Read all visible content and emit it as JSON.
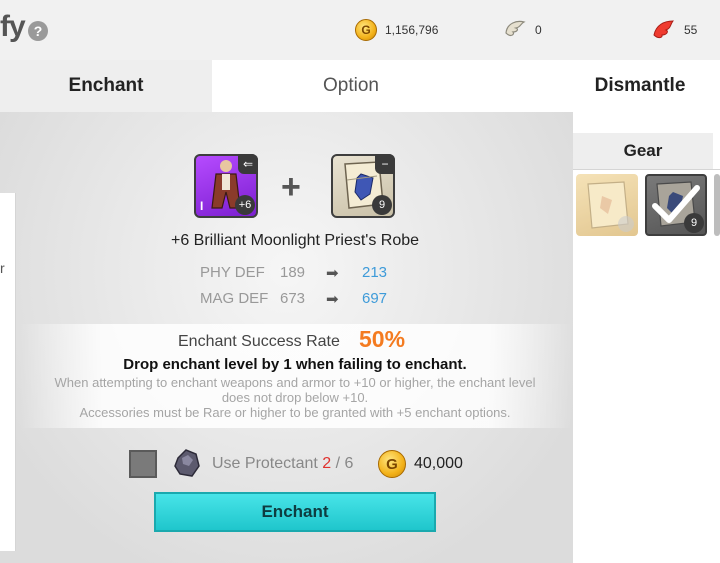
{
  "header": {
    "title": "fy",
    "help_icon": "question-icon",
    "gold": {
      "icon": "gold-coin-icon",
      "value": "1,156,796",
      "letter": "G"
    },
    "wings": {
      "icon": "wing-icon",
      "value": "0"
    },
    "feathers": {
      "icon": "red-feather-icon",
      "value": "55"
    }
  },
  "tabs": [
    {
      "label": "Enchant",
      "active": true
    },
    {
      "label": "Option",
      "active": false
    },
    {
      "label": "Dismantle",
      "active": false
    }
  ],
  "enchant": {
    "target_item": {
      "icon": "robe-icon",
      "level_badge": "+6",
      "grade": "I"
    },
    "material_item": {
      "icon": "enchant-scroll-icon",
      "count": "9"
    },
    "plus_symbol": "+",
    "item_name": "+6 Brilliant Moonlight Priest's Robe",
    "stats": [
      {
        "label": "PHY DEF",
        "from": "189",
        "to": "213"
      },
      {
        "label": "MAG DEF",
        "from": "673",
        "to": "697"
      }
    ],
    "success_rate_label": "Enchant Success Rate",
    "success_rate_value": "50%",
    "failure_text": "Drop enchant level by 1 when failing to enchant.",
    "notes": [
      "When attempting to enchant weapons and armor to +10 or higher, the enchant level",
      "does not drop below +10.",
      "Accessories must be Rare or higher to be granted with +5 enchant options."
    ],
    "protectant": {
      "label": "Use Protectant",
      "owned": "2",
      "separator": "/",
      "required": "6",
      "checked": false
    },
    "cost": {
      "value": "40,000",
      "letter": "G"
    },
    "button_label": "Enchant"
  },
  "gear_panel": {
    "tab_label": "Gear",
    "slots": [
      {
        "icon": "faded-scroll-icon"
      },
      {
        "icon": "selected-scroll-icon",
        "count": "9",
        "selected": true
      }
    ]
  },
  "left_panel": {
    "mark": "r"
  },
  "colors": {
    "accent_orange": "#f47b20",
    "stat_up_blue": "#3e9bd9",
    "button_cyan": "#2cd2d7",
    "protectant_red": "#e0322e"
  }
}
